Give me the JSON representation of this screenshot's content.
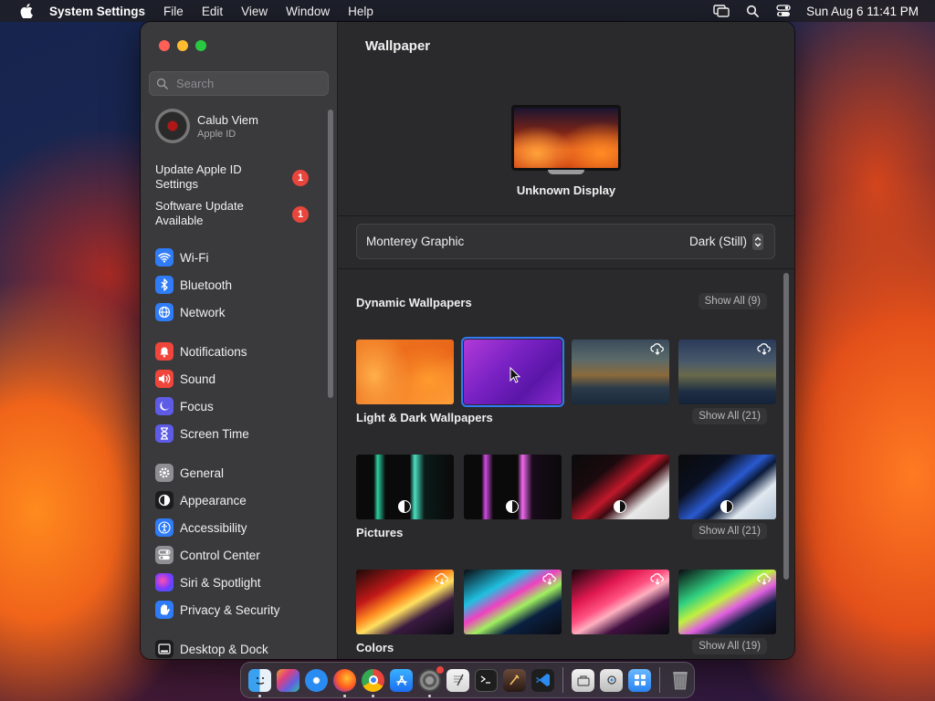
{
  "menubar": {
    "app_name": "System Settings",
    "menus": [
      "File",
      "Edit",
      "View",
      "Window",
      "Help"
    ],
    "clock": "Sun Aug 6  11:41 PM"
  },
  "window": {
    "search": {
      "placeholder": "Search",
      "value": ""
    },
    "account": {
      "name": "Calub Viem",
      "subtitle": "Apple ID"
    },
    "alerts": [
      {
        "label": "Update Apple ID Settings",
        "badge": "1"
      },
      {
        "label": "Software Update Available",
        "badge": "1"
      }
    ],
    "sidebar_items": [
      {
        "label": "Wi-Fi",
        "icon": "wifi-icon",
        "color": "#2f7cf6"
      },
      {
        "label": "Bluetooth",
        "icon": "bluetooth-icon",
        "color": "#2f7cf6"
      },
      {
        "label": "Network",
        "icon": "globe-icon",
        "color": "#2f7cf6"
      },
      {
        "label": "Notifications",
        "icon": "bell-icon",
        "color": "#f0453a"
      },
      {
        "label": "Sound",
        "icon": "speaker-icon",
        "color": "#f0453a"
      },
      {
        "label": "Focus",
        "icon": "moon-icon",
        "color": "#5e5ce6"
      },
      {
        "label": "Screen Time",
        "icon": "hourglass-icon",
        "color": "#5e5ce6"
      },
      {
        "label": "General",
        "icon": "gear-icon",
        "color": "#8e8e93"
      },
      {
        "label": "Appearance",
        "icon": "appearance-icon",
        "color": "#1c1c1e"
      },
      {
        "label": "Accessibility",
        "icon": "accessibility-icon",
        "color": "#2f7cf6"
      },
      {
        "label": "Control Center",
        "icon": "control-center-icon",
        "color": "#8e8e93"
      },
      {
        "label": "Siri & Spotlight",
        "icon": "siri-icon",
        "color": "#b23ad8"
      },
      {
        "label": "Privacy & Security",
        "icon": "hand-icon",
        "color": "#2f7cf6"
      },
      {
        "label": "Desktop & Dock",
        "icon": "dock-icon",
        "color": "#1c1c1e"
      }
    ],
    "main": {
      "title": "Wallpaper",
      "display_label": "Unknown Display",
      "selector": {
        "name": "Monterey Graphic",
        "value": "Dark (Still)"
      },
      "sections": [
        {
          "title": "Dynamic Wallpapers",
          "show_all": "Show All (9)"
        },
        {
          "title": "Light & Dark Wallpapers",
          "show_all": "Show All (21)"
        },
        {
          "title": "Pictures",
          "show_all": "Show All (21)"
        },
        {
          "title": "Colors",
          "show_all": "Show All (19)"
        }
      ]
    }
  },
  "dock": {
    "apps": [
      "Finder",
      "Launchpad",
      "Safari",
      "Firefox",
      "Chrome",
      "App Store",
      "System Settings",
      "TextEdit",
      "Terminal",
      "Xcode Utility",
      "Visual Studio Code",
      "Preview",
      "Image Capture",
      "Folder",
      "Trash"
    ]
  },
  "colors": {
    "accent": "#2f7cf6",
    "badge": "#e8453c"
  }
}
